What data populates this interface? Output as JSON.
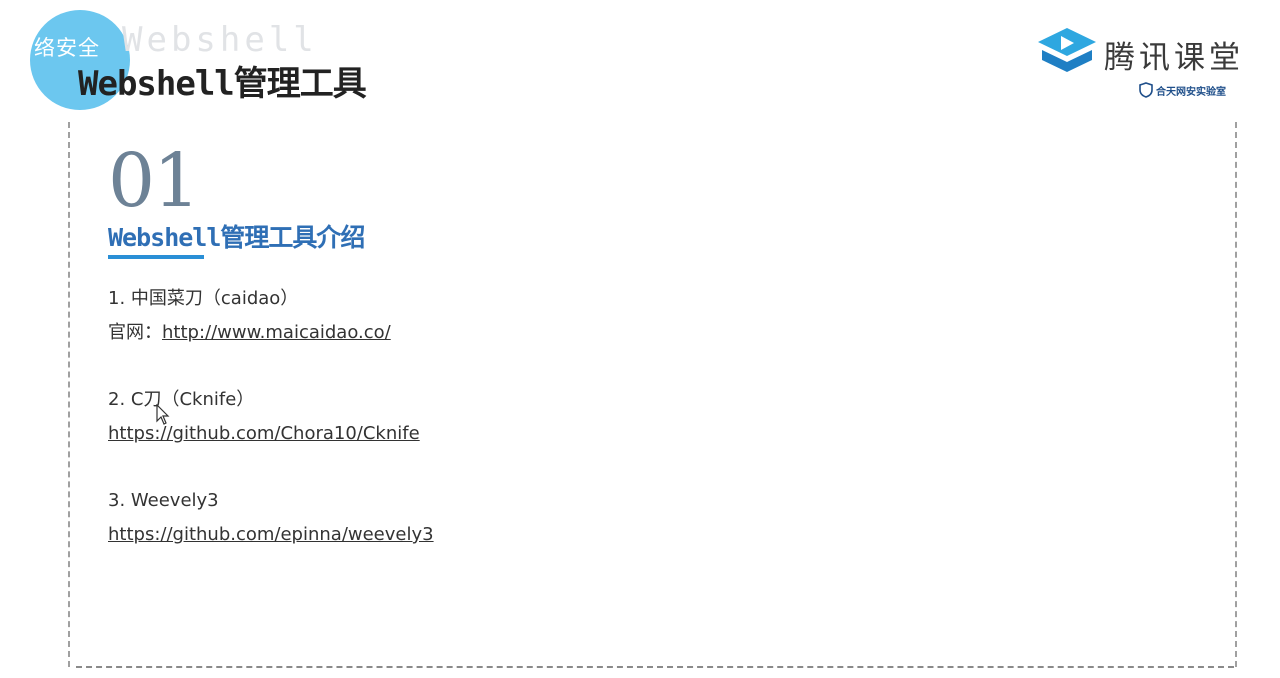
{
  "header": {
    "circle_text": "络安全",
    "ghost_text": "Webshell",
    "title": "Webshell管理工具"
  },
  "logo": {
    "name": "腾讯课堂",
    "sub": "合天网安实验室"
  },
  "section": {
    "number": "01",
    "title": "Webshell管理工具介绍"
  },
  "items": [
    {
      "title": "1. 中国菜刀（caidao）",
      "link_label": "官网：",
      "link": "http://www.maicaidao.co/"
    },
    {
      "title": "2. C刀（Cknife）",
      "link_label": "",
      "link": "https://github.com/Chora10/Cknife"
    },
    {
      "title": "3. Weevely3",
      "link_label": "",
      "link": "https://github.com/epinna/weevely3"
    }
  ]
}
